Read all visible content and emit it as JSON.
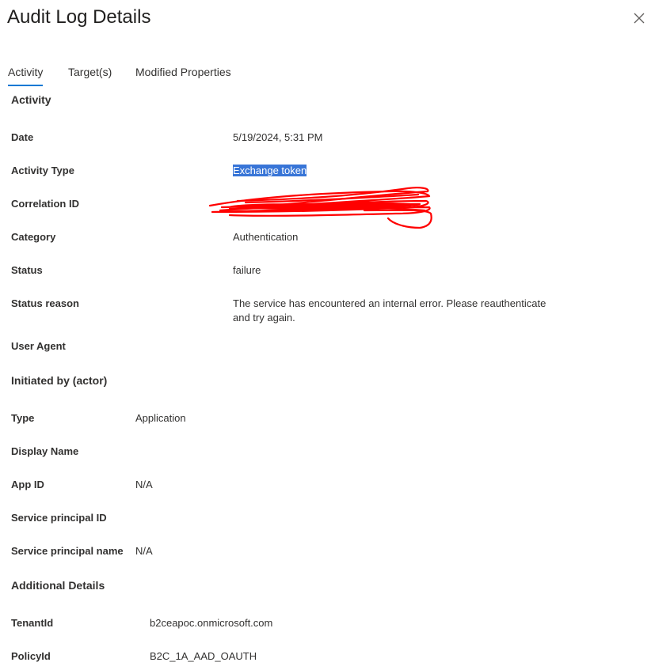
{
  "panel": {
    "title": "Audit Log Details"
  },
  "tabs": [
    {
      "label": "Activity"
    },
    {
      "label": "Target(s)"
    },
    {
      "label": "Modified Properties"
    }
  ],
  "activity": {
    "heading": "Activity",
    "date_label": "Date",
    "date_value": "5/19/2024, 5:31 PM",
    "activity_type_label": "Activity Type",
    "activity_type_value": "Exchange token",
    "correlation_id_label": "Correlation ID",
    "category_label": "Category",
    "category_value": "Authentication",
    "status_label": "Status",
    "status_value": "failure",
    "status_reason_label": "Status reason",
    "status_reason_value": "The service has encountered an internal error. Please reauthenticate and try again.",
    "user_agent_label": "User Agent"
  },
  "initiated_by": {
    "heading": "Initiated by (actor)",
    "type_label": "Type",
    "type_value": "Application",
    "display_name_label": "Display Name",
    "app_id_label": "App ID",
    "app_id_value": "N/A",
    "service_principal_id_label": "Service principal ID",
    "service_principal_name_label": "Service principal name",
    "service_principal_name_value": "N/A"
  },
  "additional_details": {
    "heading": "Additional Details",
    "tenant_id_label": "TenantId",
    "tenant_id_value": "b2ceapoc.onmicrosoft.com",
    "policy_id_label": "PolicyId",
    "policy_id_value": "B2C_1A_AAD_OAUTH"
  },
  "colors": {
    "accent": "#0078d4",
    "selection": "#3875d7",
    "redaction": "#ff0000"
  },
  "icons": {
    "close": "close-icon"
  }
}
